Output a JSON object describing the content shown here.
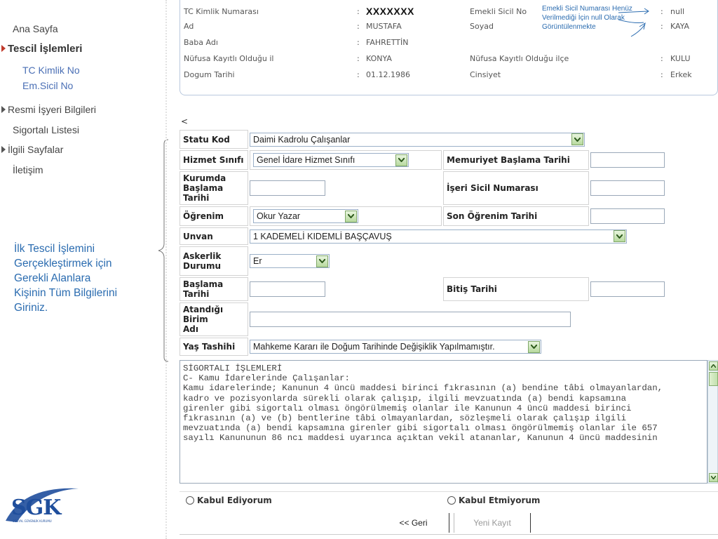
{
  "sidebar": {
    "items": [
      {
        "label": "Ana Sayfa"
      },
      {
        "label": "Tescil İşlemleri"
      },
      {
        "label": "TC Kimlik No"
      },
      {
        "label": "Em.Sicil No"
      },
      {
        "label": "Resmi İşyeri Bilgileri"
      },
      {
        "label": "Sigortalı Listesi"
      },
      {
        "label": "İlgili Sayfalar"
      },
      {
        "label": "İletişim"
      }
    ]
  },
  "annotation": {
    "lines": [
      "İlk Tescil İşlemini",
      "Gerçekleştirmek için",
      "Gerekli Alanlara",
      "Kişinin Tüm Bilgilerini",
      "Giriniz."
    ]
  },
  "logo": {
    "text": "SGK",
    "sub": "SOSYAL GÜVENLİK KURUMU"
  },
  "info": {
    "tc_label": "TC Kimlik Numarası",
    "tc_value": "XXXXXXX",
    "emekli_label": "Emekli Sicil No",
    "emekli_value": "null",
    "ad_label": "Ad",
    "ad_value": "MUSTAFA",
    "soyad_label": "Soyad",
    "soyad_value": "KAYA",
    "baba_label": "Baba Adı",
    "baba_value": "FAHRETTİN",
    "il_label": "Nüfusa Kayıtlı Olduğu il",
    "il_value": "KONYA",
    "ilce_label": "Nüfusa Kayıtlı Olduğu ilçe",
    "ilce_value": "KULU",
    "dogum_label": "Dogum Tarihi",
    "dogum_value": "01.12.1986",
    "cinsiyet_label": "Cinsiyet",
    "cinsiyet_value": "Erkek",
    "colon": ":",
    "note_lines": [
      "Emekli Sicil Numarası Henüz",
      "Verilmediği İçin null Olarak",
      "Görüntülenmekte"
    ]
  },
  "lt_symbol": "<",
  "form": {
    "statu_label": "Statu Kod",
    "statu_value": "Daimi Kadrolu Çalışanlar",
    "hizmet_label": "Hizmet Sınıfı",
    "hizmet_value": "Genel İdare Hizmet Sınıfı",
    "memuriyet_label": "Memuriyet Başlama Tarihi",
    "kurum_label_1": "Kurumda",
    "kurum_label_2": "Başlama Tarihi",
    "iseri_label": "İşeri Sicil Numarası",
    "ogrenim_label": "Öğrenim",
    "ogrenim_value": "Okur Yazar",
    "son_ogrenim_label": "Son Öğrenim Tarihi",
    "unvan_label": "Unvan",
    "unvan_value": "1 KADEMELİ KIDEMLİ BAŞÇAVUŞ",
    "askerlik_label_1": "Askerlik",
    "askerlik_label_2": "Durumu",
    "askerlik_value": "Er",
    "baslama_label": "Başlama Tarihi",
    "bitis_label": "Bitiş Tarihi",
    "birim_label_1": "Atandığı Birim",
    "birim_label_2": "Adı",
    "yas_label": "Yaş Tashihi",
    "yas_value": "Mahkeme Kararı ile Doğum Tarihinde Değişiklik Yapılmamıştır."
  },
  "textarea": {
    "lines": [
      "SİGORTALI İŞLEMLERİ",
      "",
      "C- Kamu İdarelerinde Çalışanlar:",
      "",
      "Kamu idarelerinde; Kanunun 4 üncü maddesi birinci fıkrasının (a) bendine tâbi olmayanlardan,",
      "kadro ve pozisyonlarda sürekli olarak çalışıp, ilgili mevzuatında (a) bendi kapsamına",
      "girenler gibi sigortalı olması öngörülmemiş olanlar ile Kanunun 4 üncü maddesi birinci",
      "fıkrasının (a) ve (b) bentlerine tâbi olmayanlardan, sözleşmeli olarak çalışıp ilgili",
      "mevzuatında (a) bendi kapsamına girenler gibi sigortalı olması öngörülmemiş olanlar ile 657",
      "sayılı Kanununun 86 ncı maddesi uyarınca açıktan vekil atananlar, Kanunun 4 üncü maddesinin"
    ]
  },
  "radios": {
    "kabul": "Kabul Ediyorum",
    "ret": "Kabul Etmiyorum"
  },
  "buttons": {
    "geri": "<< Geri",
    "yeni": "Yeni Kayıt"
  }
}
